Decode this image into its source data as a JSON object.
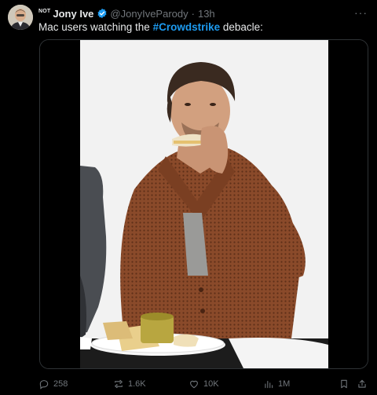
{
  "tweet": {
    "author": {
      "prefix": "NOT",
      "name": "Jony Ive",
      "handle": "@JonyIveParody",
      "separator": "·",
      "time": "13h"
    },
    "more_label": "···",
    "text": {
      "before": "Mac users watching the ",
      "hashtag": "#Crowdstrike",
      "after": " debacle:"
    },
    "stats": {
      "replies": "258",
      "reposts": "1.6K",
      "likes": "10K",
      "views": "1M"
    }
  },
  "colors": {
    "background": "#000000",
    "text": "#e7e9ea",
    "muted": "#71767b",
    "accent": "#1d9bf0",
    "sweater": "#8a4a2a"
  },
  "icons": [
    "verified-badge-icon",
    "more-icon",
    "reply-icon",
    "repost-icon",
    "like-icon",
    "views-icon",
    "bookmark-icon",
    "share-icon"
  ]
}
